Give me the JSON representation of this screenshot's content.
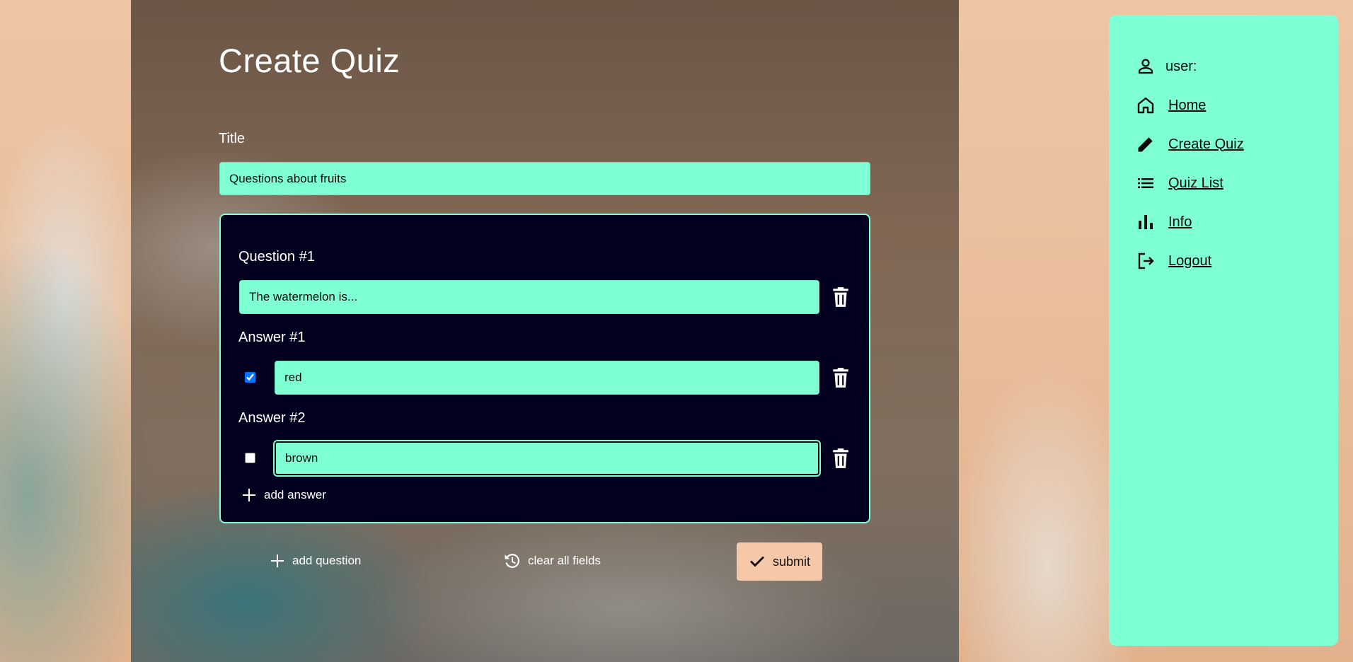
{
  "page": {
    "title": "Create Quiz",
    "colors": {
      "accent": "#7fffd4",
      "card_bg": "#03001f",
      "submit_bg": "#f4c8a8"
    }
  },
  "form": {
    "title_label": "Title",
    "title_value": "Questions about fruits",
    "questions": [
      {
        "label": "Question #1",
        "value": "The watermelon is...",
        "answers": [
          {
            "label": "Answer #1",
            "value": "red",
            "correct": true
          },
          {
            "label": "Answer #2",
            "value": "brown",
            "correct": false
          }
        ],
        "add_answer_label": "add answer"
      }
    ],
    "add_question_label": "add question",
    "clear_label": "clear all fields",
    "submit_label": "submit"
  },
  "sidebar": {
    "user_label": "user:",
    "items": [
      {
        "label": "Home",
        "icon": "home-icon"
      },
      {
        "label": "Create Quiz",
        "icon": "pencil-icon"
      },
      {
        "label": "Quiz List",
        "icon": "list-icon"
      },
      {
        "label": "Info",
        "icon": "bar-chart-icon"
      },
      {
        "label": "Logout",
        "icon": "logout-icon"
      }
    ]
  }
}
